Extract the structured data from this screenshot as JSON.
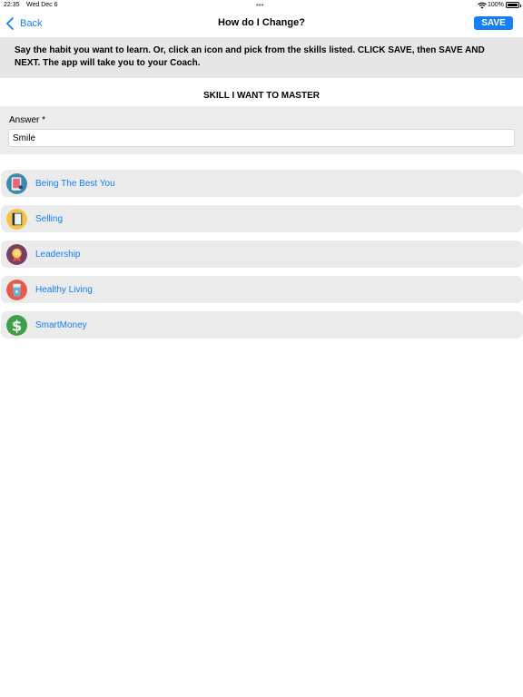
{
  "status": {
    "time": "22:35",
    "date": "Wed Dec 6",
    "battery_percent": "100%",
    "battery_level": 1.0,
    "multitask_dots": "•••"
  },
  "nav": {
    "back_label": "Back",
    "title": "How do I Change?",
    "save_label": "SAVE"
  },
  "instructions": "Say the habit you want to learn. Or, click an icon and pick from the skills listed.  CLICK SAVE, then SAVE AND NEXT. The app will take you to your Coach.",
  "section_heading": "SKILL I WANT TO MASTER",
  "answer": {
    "label": "Answer *",
    "value": "Smile"
  },
  "skills": [
    {
      "label": "Being The Best You",
      "icon": "tablet-icon",
      "color": "#3a8bb0"
    },
    {
      "label": "Selling",
      "icon": "book-icon",
      "color": "#f4c542"
    },
    {
      "label": "Leadership",
      "icon": "medal-icon",
      "color": "#7a3e64"
    },
    {
      "label": "Healthy Living",
      "icon": "water-glass-icon",
      "color": "#e45a4d"
    },
    {
      "label": "SmartMoney",
      "icon": "dollar-icon",
      "color": "#3f9f4a"
    }
  ],
  "colors": {
    "accent": "#147efb",
    "panel": "#e6e6e6"
  }
}
